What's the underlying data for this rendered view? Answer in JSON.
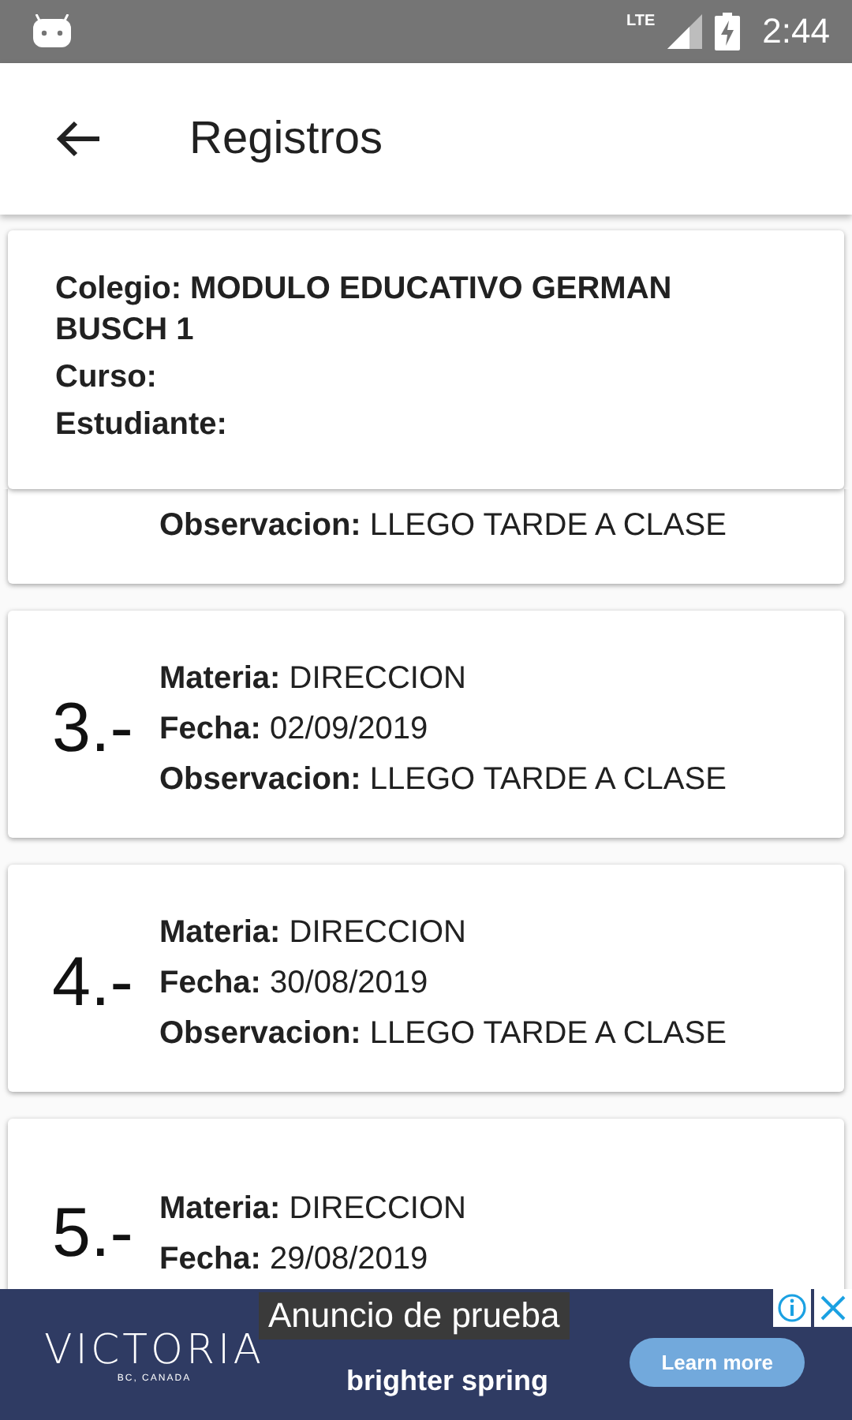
{
  "status_bar": {
    "network": "LTE",
    "time": "2:44"
  },
  "app_bar": {
    "title": "Registros"
  },
  "header": {
    "fields": [
      {
        "label": "Colegio:",
        "value": "MODULO EDUCATIVO GERMAN BUSCH 1"
      },
      {
        "label": "Curso:"
      },
      {
        "label": "Estudiante:"
      }
    ]
  },
  "records": [
    {
      "kind": "partial",
      "fields": [
        {
          "label": "Observacion:",
          "value": "LLEGO TARDE A CLASE"
        }
      ]
    },
    {
      "kind": "full",
      "number": "3.-",
      "fields": [
        {
          "label": "Materia:",
          "value": "DIRECCION"
        },
        {
          "label": "Fecha:",
          "value": "02/09/2019"
        },
        {
          "label": "Observacion:",
          "value": "LLEGO TARDE A CLASE"
        }
      ]
    },
    {
      "kind": "full",
      "number": "4.-",
      "fields": [
        {
          "label": "Materia:",
          "value": "DIRECCION"
        },
        {
          "label": "Fecha:",
          "value": "30/08/2019"
        },
        {
          "label": "Observacion:",
          "value": "LLEGO TARDE A CLASE"
        }
      ]
    },
    {
      "kind": "full",
      "number": "5.-",
      "fields": [
        {
          "label": "Materia:",
          "value": "DIRECCION"
        },
        {
          "label": "Fecha:",
          "value": "29/08/2019"
        }
      ]
    }
  ],
  "ad": {
    "label": "Anuncio de prueba",
    "brand": "VICTORIA",
    "brand_sub": "BC, CANADA",
    "headline": "brighter spring",
    "button": "Learn more"
  }
}
